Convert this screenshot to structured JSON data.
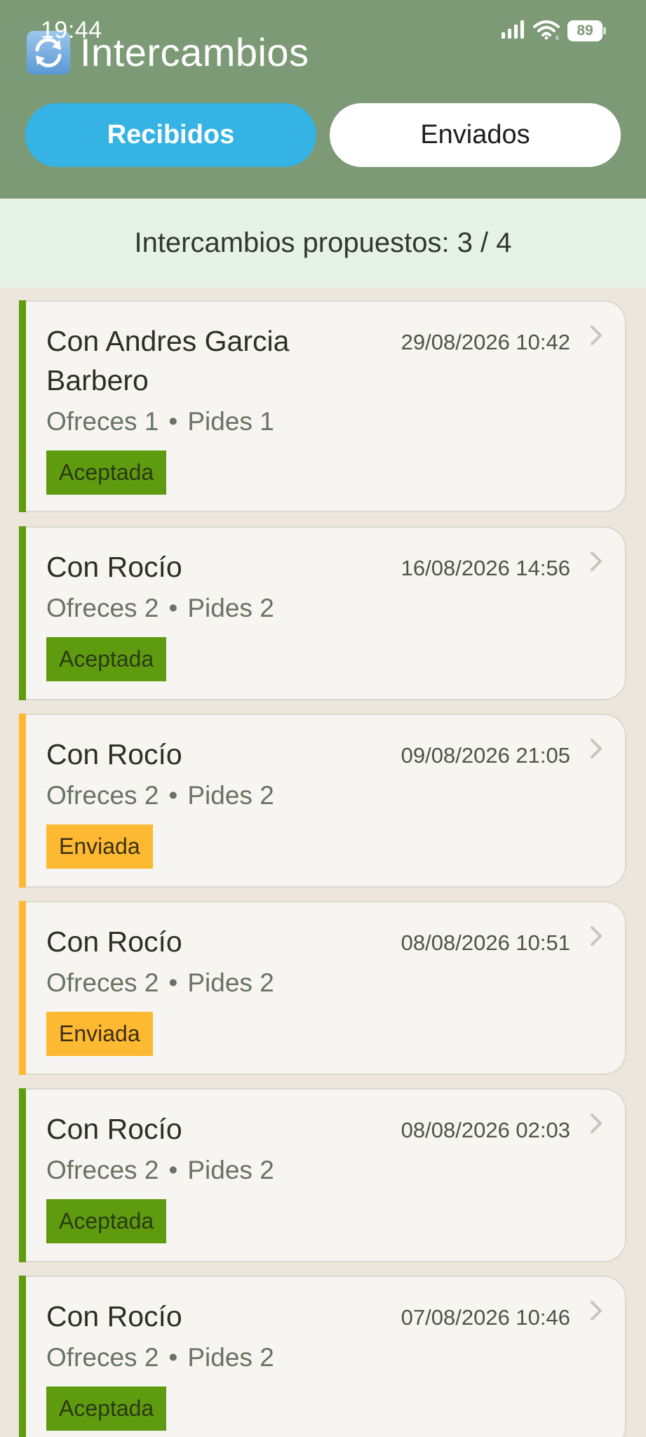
{
  "status_bar": {
    "time": "19:44",
    "battery": "89",
    "icons": [
      "signal-icon",
      "wifi-icon",
      "battery-icon"
    ]
  },
  "header": {
    "icon": "exchange-arrows-icon",
    "title": "Intercambios"
  },
  "tabs": [
    {
      "label": "Recibidos",
      "active": true
    },
    {
      "label": "Enviados",
      "active": false
    }
  ],
  "counter": {
    "text": "Intercambios propuestos: 3 / 4"
  },
  "colors": {
    "header_bg": "#7d9a77",
    "tab_active": "#34b3e4",
    "accepted": "#5f9b0f",
    "sent": "#fdb931"
  },
  "exchanges": [
    {
      "name": "Con Andres Garcia Barbero",
      "date": "29/08/2026 10:42",
      "offers": "Ofreces 1",
      "asks": "Pides 1",
      "dot": "•",
      "status": "Aceptada",
      "status_type": "accepted"
    },
    {
      "name": "Con Rocío",
      "date": "16/08/2026 14:56",
      "offers": "Ofreces 2",
      "asks": "Pides 2",
      "dot": "•",
      "status": "Aceptada",
      "status_type": "accepted"
    },
    {
      "name": "Con Rocío",
      "date": "09/08/2026 21:05",
      "offers": "Ofreces 2",
      "asks": "Pides 2",
      "dot": "•",
      "status": "Enviada",
      "status_type": "sent"
    },
    {
      "name": "Con Rocío",
      "date": "08/08/2026 10:51",
      "offers": "Ofreces 2",
      "asks": "Pides 2",
      "dot": "•",
      "status": "Enviada",
      "status_type": "sent"
    },
    {
      "name": "Con Rocío",
      "date": "08/08/2026 02:03",
      "offers": "Ofreces 2",
      "asks": "Pides 2",
      "dot": "•",
      "status": "Aceptada",
      "status_type": "accepted"
    },
    {
      "name": "Con Rocío",
      "date": "07/08/2026 10:46",
      "offers": "Ofreces 2",
      "asks": "Pides 2",
      "dot": "•",
      "status": "Aceptada",
      "status_type": "accepted"
    }
  ]
}
